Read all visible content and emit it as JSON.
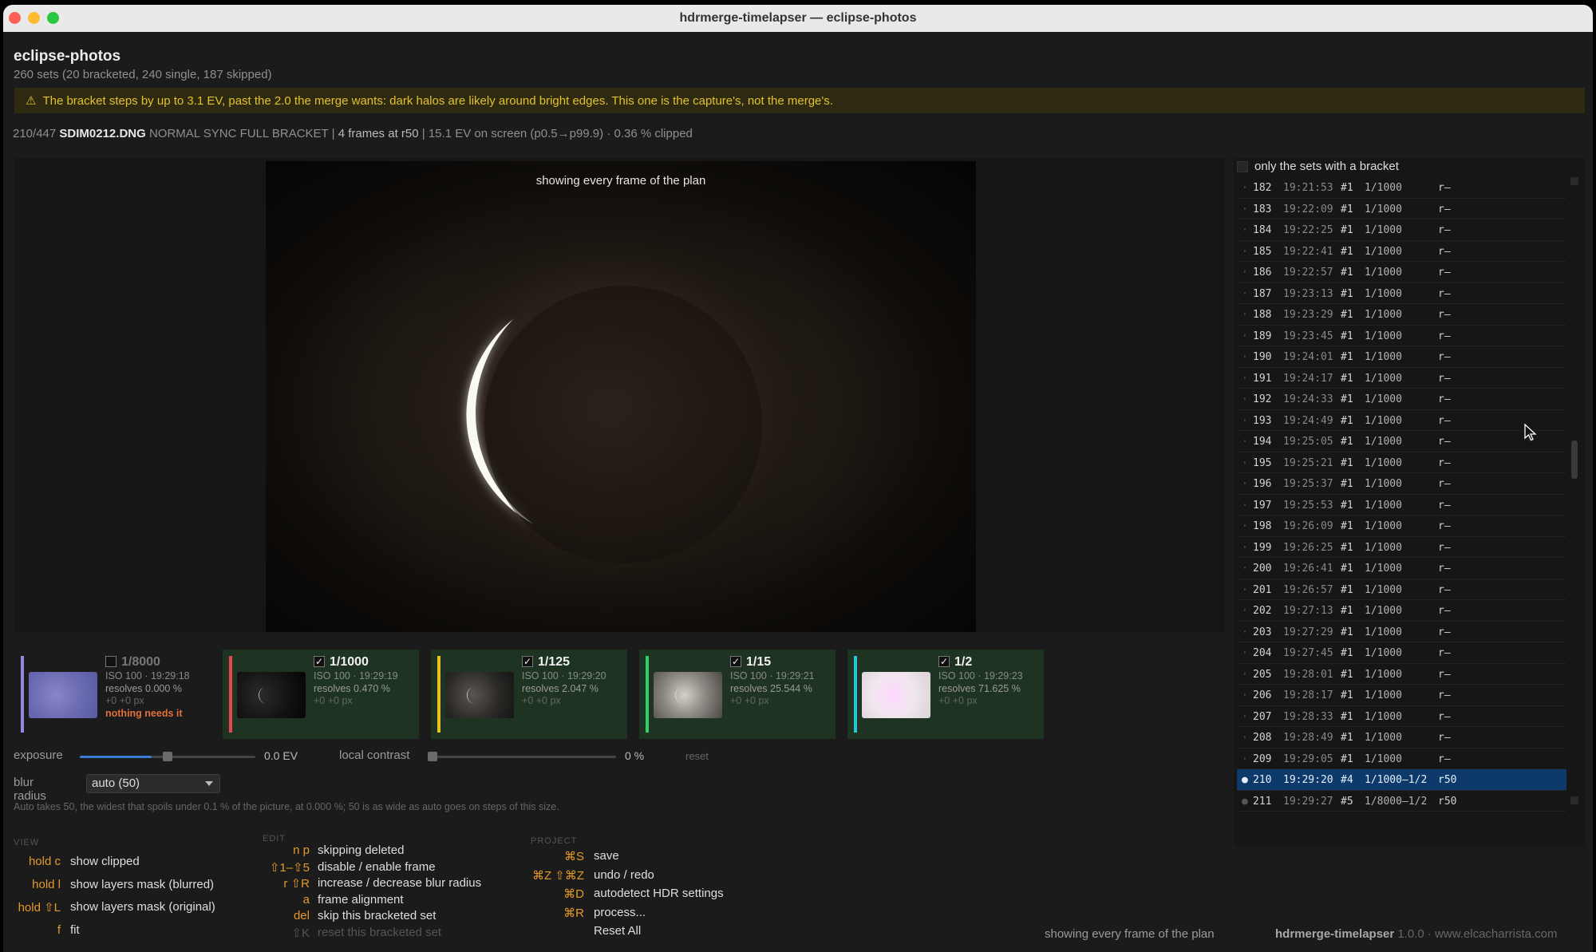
{
  "window": {
    "title": "hdrmerge-timelapser — eclipse-photos"
  },
  "project": {
    "name": "eclipse-photos",
    "summary": "260 sets (20 bracketed, 240 single, 187 skipped)"
  },
  "warning": {
    "icon": "warning-icon",
    "text": "The bracket steps by up to 3.1 EV, past the 2.0 the merge wants: dark halos are likely around bright edges. This one is the capture's, not the merge's."
  },
  "info": {
    "position": "210/447",
    "filename": "SDIM0212.DNG",
    "mode": "NORMAL SYNC FULL BRACKET",
    "frames": "4 frames at r50",
    "ev": "15.1 EV on screen (p0.5→p99.9) · 0.36 % clipped"
  },
  "viewer": {
    "label": "showing every frame of the plan"
  },
  "frames": [
    {
      "enabled": false,
      "check": "",
      "shutter": "1/8000",
      "iso_time": "ISO 100 · 19:29:18",
      "resolves": "resolves 0.000 %",
      "offset": "+0 +0 px",
      "note": "nothing needs it",
      "color": "#9a86e0"
    },
    {
      "enabled": true,
      "check": "✓",
      "shutter": "1/1000",
      "iso_time": "ISO 100 · 19:29:19",
      "resolves": "resolves 0.470 %",
      "offset": "+0 +0 px",
      "note": "",
      "color": "#e5484d"
    },
    {
      "enabled": true,
      "check": "✓",
      "shutter": "1/125",
      "iso_time": "ISO 100 · 19:29:20",
      "resolves": "resolves 2.047 %",
      "offset": "+0 +0 px",
      "note": "",
      "color": "#e8c21e"
    },
    {
      "enabled": true,
      "check": "✓",
      "shutter": "1/15",
      "iso_time": "ISO 100 · 19:29:21",
      "resolves": "resolves 25.544 %",
      "offset": "+0 +0 px",
      "note": "",
      "color": "#2fcf6a"
    },
    {
      "enabled": true,
      "check": "✓",
      "shutter": "1/2",
      "iso_time": "ISO 100 · 19:29:23",
      "resolves": "resolves 71.625 %",
      "offset": "+0 +0 px",
      "note": "",
      "color": "#25c6d9"
    }
  ],
  "controls": {
    "exposure_label": "exposure",
    "exposure_value": "0.0 EV",
    "exposure_fraction": 0.5,
    "contrast_label": "local contrast",
    "contrast_value": "0 %",
    "contrast_fraction": 0.0,
    "reset_label": "reset",
    "blur_label": "blur radius",
    "blur_value": "auto (50)",
    "help": "Auto takes 50, the widest that spoils under 0.1 % of the picture, at 0.000 %; 50 is as wide as auto goes on steps of this size."
  },
  "shortcuts": {
    "view_title": "VIEW",
    "view": [
      {
        "key": "hold c",
        "action": "show clipped"
      },
      {
        "key": "hold l",
        "action": "show layers mask (blurred)"
      },
      {
        "key": "hold ⇧L",
        "action": "show layers mask (original)"
      },
      {
        "key": "f",
        "action": "fit"
      }
    ],
    "edit_title": "EDIT",
    "edit": [
      {
        "key": "n p",
        "action": "skipping deleted"
      },
      {
        "key": "⇧1–⇧5",
        "action": "disable / enable frame"
      },
      {
        "key": "r ⇧R",
        "action": "increase / decrease blur radius"
      },
      {
        "key": "a",
        "action": "frame alignment"
      },
      {
        "key": "del",
        "action": "skip this bracketed set"
      },
      {
        "key": "⇧K",
        "action": "reset this bracketed set"
      }
    ],
    "project_title": "PROJECT",
    "project": [
      {
        "key": "⌘S",
        "action": "save"
      },
      {
        "key": "⌘Z ⇧⌘Z",
        "action": "undo / redo"
      },
      {
        "key": "⌘D",
        "action": "autodetect HDR settings"
      },
      {
        "key": "⌘R",
        "action": "process..."
      },
      {
        "key": "",
        "action": "Reset All"
      }
    ]
  },
  "status": {
    "left": "showing every frame of the plan",
    "app": "hdrmerge-timelapser",
    "version": "1.0.0 · www.elcacharrista.com"
  },
  "set_panel": {
    "filter_label": "only the sets with a bracket",
    "rows": [
      {
        "dot": "·",
        "num": "182",
        "time": "19:21:53",
        "frame": "#1",
        "shutter": "1/1000",
        "radius": "r–"
      },
      {
        "dot": "·",
        "num": "183",
        "time": "19:22:09",
        "frame": "#1",
        "shutter": "1/1000",
        "radius": "r–"
      },
      {
        "dot": "·",
        "num": "184",
        "time": "19:22:25",
        "frame": "#1",
        "shutter": "1/1000",
        "radius": "r–"
      },
      {
        "dot": "·",
        "num": "185",
        "time": "19:22:41",
        "frame": "#1",
        "shutter": "1/1000",
        "radius": "r–"
      },
      {
        "dot": "·",
        "num": "186",
        "time": "19:22:57",
        "frame": "#1",
        "shutter": "1/1000",
        "radius": "r–"
      },
      {
        "dot": "·",
        "num": "187",
        "time": "19:23:13",
        "frame": "#1",
        "shutter": "1/1000",
        "radius": "r–"
      },
      {
        "dot": "·",
        "num": "188",
        "time": "19:23:29",
        "frame": "#1",
        "shutter": "1/1000",
        "radius": "r–"
      },
      {
        "dot": "·",
        "num": "189",
        "time": "19:23:45",
        "frame": "#1",
        "shutter": "1/1000",
        "radius": "r–"
      },
      {
        "dot": "·",
        "num": "190",
        "time": "19:24:01",
        "frame": "#1",
        "shutter": "1/1000",
        "radius": "r–"
      },
      {
        "dot": "·",
        "num": "191",
        "time": "19:24:17",
        "frame": "#1",
        "shutter": "1/1000",
        "radius": "r–"
      },
      {
        "dot": "·",
        "num": "192",
        "time": "19:24:33",
        "frame": "#1",
        "shutter": "1/1000",
        "radius": "r–"
      },
      {
        "dot": "·",
        "num": "193",
        "time": "19:24:49",
        "frame": "#1",
        "shutter": "1/1000",
        "radius": "r–"
      },
      {
        "dot": "·",
        "num": "194",
        "time": "19:25:05",
        "frame": "#1",
        "shutter": "1/1000",
        "radius": "r–"
      },
      {
        "dot": "·",
        "num": "195",
        "time": "19:25:21",
        "frame": "#1",
        "shutter": "1/1000",
        "radius": "r–"
      },
      {
        "dot": "·",
        "num": "196",
        "time": "19:25:37",
        "frame": "#1",
        "shutter": "1/1000",
        "radius": "r–"
      },
      {
        "dot": "·",
        "num": "197",
        "time": "19:25:53",
        "frame": "#1",
        "shutter": "1/1000",
        "radius": "r–"
      },
      {
        "dot": "·",
        "num": "198",
        "time": "19:26:09",
        "frame": "#1",
        "shutter": "1/1000",
        "radius": "r–"
      },
      {
        "dot": "·",
        "num": "199",
        "time": "19:26:25",
        "frame": "#1",
        "shutter": "1/1000",
        "radius": "r–"
      },
      {
        "dot": "·",
        "num": "200",
        "time": "19:26:41",
        "frame": "#1",
        "shutter": "1/1000",
        "radius": "r–"
      },
      {
        "dot": "·",
        "num": "201",
        "time": "19:26:57",
        "frame": "#1",
        "shutter": "1/1000",
        "radius": "r–"
      },
      {
        "dot": "·",
        "num": "202",
        "time": "19:27:13",
        "frame": "#1",
        "shutter": "1/1000",
        "radius": "r–"
      },
      {
        "dot": "·",
        "num": "203",
        "time": "19:27:29",
        "frame": "#1",
        "shutter": "1/1000",
        "radius": "r–"
      },
      {
        "dot": "·",
        "num": "204",
        "time": "19:27:45",
        "frame": "#1",
        "shutter": "1/1000",
        "radius": "r–"
      },
      {
        "dot": "·",
        "num": "205",
        "time": "19:28:01",
        "frame": "#1",
        "shutter": "1/1000",
        "radius": "r–"
      },
      {
        "dot": "·",
        "num": "206",
        "time": "19:28:17",
        "frame": "#1",
        "shutter": "1/1000",
        "radius": "r–"
      },
      {
        "dot": "·",
        "num": "207",
        "time": "19:28:33",
        "frame": "#1",
        "shutter": "1/1000",
        "radius": "r–"
      },
      {
        "dot": "·",
        "num": "208",
        "time": "19:28:49",
        "frame": "#1",
        "shutter": "1/1000",
        "radius": "r–"
      },
      {
        "dot": "·",
        "num": "209",
        "time": "19:29:05",
        "frame": "#1",
        "shutter": "1/1000",
        "radius": "r–"
      },
      {
        "dot": "●",
        "num": "210",
        "time": "19:29:20",
        "frame": "#4",
        "shutter": "1/1000–1/2",
        "radius": "r50",
        "selected": true
      },
      {
        "dot": "●",
        "num": "211",
        "time": "19:29:27",
        "frame": "#5",
        "shutter": "1/8000–1/2",
        "radius": "r50"
      }
    ]
  }
}
